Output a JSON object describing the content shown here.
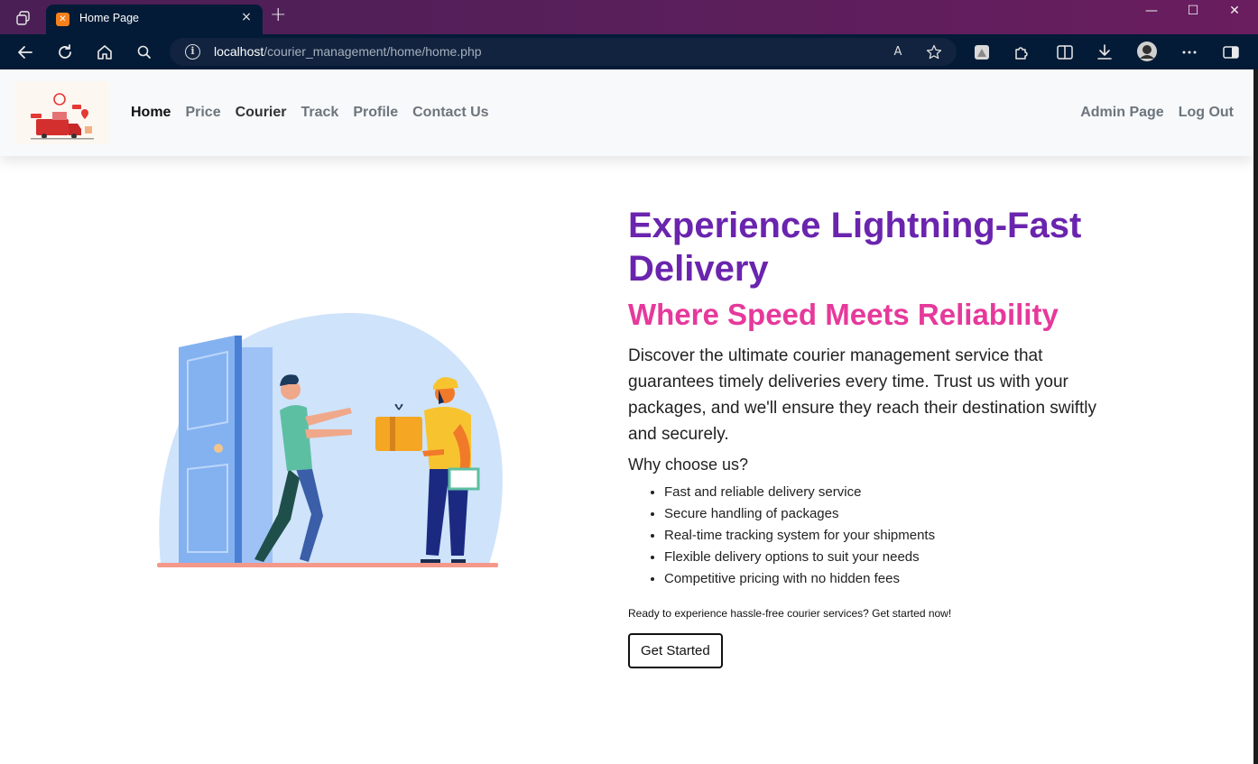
{
  "browser": {
    "tab_title": "Home Page",
    "tab_close": "×",
    "new_tab": "+",
    "url_host": "localhost",
    "url_path": "/courier_management/home/home.php",
    "window_minimize": "—",
    "window_maximize": "☐",
    "window_close": "✕"
  },
  "navbar": {
    "links": [
      "Home",
      "Price",
      "Courier",
      "Track",
      "Profile",
      "Contact Us"
    ],
    "right_links": [
      "Admin Page",
      "Log Out"
    ]
  },
  "hero": {
    "title": "Experience Lightning-Fast Delivery",
    "subtitle": "Where Speed Meets Reliability",
    "description": "Discover the ultimate courier management service that guarantees timely deliveries every time. Trust us with your packages, and we'll ensure they reach their destination swiftly and securely.",
    "why_heading": "Why choose us?",
    "reasons": [
      "Fast and reliable delivery service",
      "Secure handling of packages",
      "Real-time tracking system for your shipments",
      "Flexible delivery options to suit your needs",
      "Competitive pricing with no hidden fees"
    ],
    "cta_text": "Ready to experience hassle-free courier services? Get started now!",
    "cta_button": "Get Started"
  },
  "colors": {
    "title": "#6a24ae",
    "subtitle": "#e6399b",
    "browser_bar": "#031b36"
  }
}
